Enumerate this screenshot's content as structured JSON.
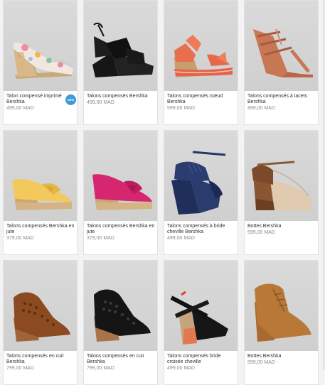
{
  "products": [
    {
      "name": "Talon compensé imprimé Bershka",
      "price": "499,00 MAD",
      "image": "floral-espadrille-wedge-icon",
      "badge": "NEW"
    },
    {
      "name": "Talons compensés Bershka",
      "price": "499,00 MAD",
      "image": "black-strappy-wedge-icon"
    },
    {
      "name": "Talons compensés nœud Bershka",
      "price": "599,00 MAD",
      "image": "coral-bow-wedge-icon"
    },
    {
      "name": "Talons compensés à lacets Bershka",
      "price": "499,00 MAD",
      "image": "tan-lace-up-wedge-icon"
    },
    {
      "name": "Talons compensés Bershka en jute",
      "price": "379,00 MAD",
      "image": "yellow-jute-wedge-icon"
    },
    {
      "name": "Talons compensés Bershka en jute",
      "price": "379,00 MAD",
      "image": "pink-jute-wedge-icon"
    },
    {
      "name": "Talons compensés à bride cheville Bershka",
      "price": "499,00 MAD",
      "image": "navy-ankle-strap-wedge-icon"
    },
    {
      "name": "Bottes Bershka",
      "price": "599,00 MAD",
      "image": "beige-wedge-bootie-icon"
    },
    {
      "name": "Talons compensés en cuir Bershka",
      "price": "799,00 MAD",
      "image": "brown-cutout-bootie-icon"
    },
    {
      "name": "Talons compensés en cuir Bershka",
      "price": "799,00 MAD",
      "image": "black-cutout-bootie-icon"
    },
    {
      "name": "Talons compensés bride croisée cheville",
      "price": "499,00 MAD",
      "image": "black-cross-strap-wedge-icon"
    },
    {
      "name": "Bottes Bershka",
      "price": "599,00 MAD",
      "image": "camel-wedge-bootie-icon"
    }
  ]
}
